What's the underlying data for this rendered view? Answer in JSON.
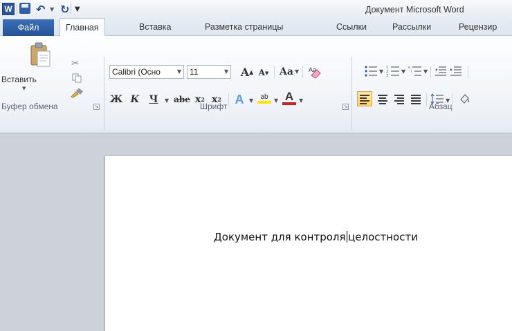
{
  "window": {
    "title": "Документ Microsoft Word",
    "app_icon_letter": "W"
  },
  "tabs": [
    {
      "label": "Файл"
    },
    {
      "label": "Главная"
    },
    {
      "label": "Вставка"
    },
    {
      "label": "Разметка страницы"
    },
    {
      "label": "Ссылки"
    },
    {
      "label": "Рассылки"
    },
    {
      "label": "Рецензир"
    }
  ],
  "ribbon": {
    "clipboard": {
      "group_label": "Буфер обмена",
      "paste_label": "Вставить"
    },
    "font": {
      "group_label": "Шрифт",
      "font_name": "Calibri (Осно",
      "font_size": "11",
      "grow_label": "A",
      "shrink_label": "A",
      "case_label": "Aa",
      "bold_label": "Ж",
      "italic_label": "К",
      "underline_label": "Ч",
      "strike_label": "abe",
      "subscript_label": "x",
      "superscript_label": "x",
      "effects_label": "A",
      "highlight_label": "ab",
      "color_label": "A",
      "color_accent": "#d11f1f",
      "highlight_accent": "#ffe600"
    },
    "paragraph": {
      "group_label": "Абзац"
    }
  },
  "document": {
    "text_before_caret": "Документ для контроля",
    "text_after_caret": "целостности"
  },
  "colors": {
    "file_tab": "#2b579a",
    "accent_selected": "#ffd36a"
  }
}
